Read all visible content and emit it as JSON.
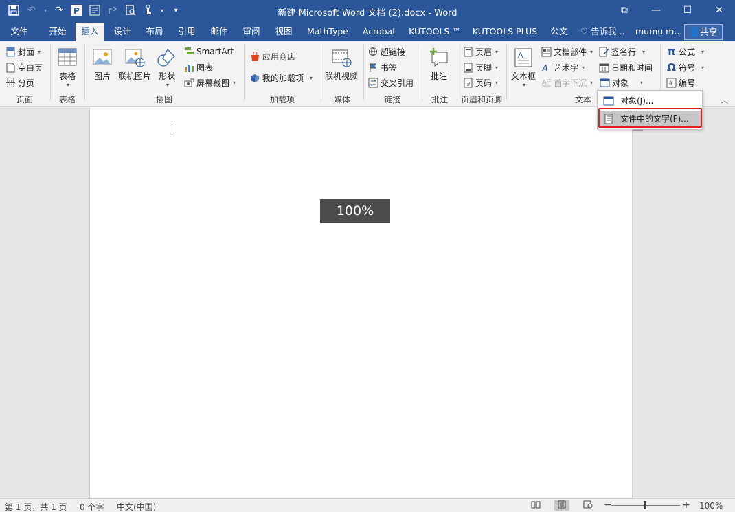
{
  "window": {
    "title": "新建 Microsoft Word 文档 (2).docx - Word",
    "controls": [
      "⧉",
      "—",
      "☐",
      "✕"
    ]
  },
  "qat": {
    "icons": [
      "save-icon",
      "undo-icon",
      "redo-icon",
      "powerpoint-icon",
      "mathtype-icon",
      "share-icon",
      "print-preview-icon",
      "touch-mode-icon",
      "customize-icon"
    ],
    "glyphs": [
      "💾",
      "↶",
      "↷",
      "P",
      "⊞",
      "↗",
      "🔍",
      "☝",
      "▾"
    ]
  },
  "tabs": [
    {
      "label": "文件"
    },
    {
      "label": "开始"
    },
    {
      "label": "插入"
    },
    {
      "label": "设计"
    },
    {
      "label": "布局"
    },
    {
      "label": "引用"
    },
    {
      "label": "邮件"
    },
    {
      "label": "审阅"
    },
    {
      "label": "视图"
    },
    {
      "label": "MathType"
    },
    {
      "label": "Acrobat"
    },
    {
      "label": "KUTOOLS ™"
    },
    {
      "label": "KUTOOLS PLUS"
    },
    {
      "label": "公文"
    }
  ],
  "tellme": "♡ 告诉我...",
  "user": "mumu m...",
  "share": "共享",
  "ribbon": {
    "pages": {
      "cover": "封面",
      "blank": "空白页",
      "break": "分页",
      "label": "页面"
    },
    "tables": {
      "table": "表格",
      "label": "表格"
    },
    "illustrations": {
      "picture": "图片",
      "online_picture": "联机图片",
      "shapes": "形状",
      "smartart": "SmartArt",
      "chart": "图表",
      "screenshot": "屏幕截图",
      "label": "插图"
    },
    "addins": {
      "store": "应用商店",
      "my_addins": "我的加载项",
      "label": "加载项"
    },
    "media": {
      "online_video": "联机视频",
      "label": "媒体"
    },
    "links": {
      "hyperlink": "超链接",
      "bookmark": "书签",
      "crossref": "交叉引用",
      "label": "链接"
    },
    "comments": {
      "comment": "批注",
      "label": "批注"
    },
    "headerfooter": {
      "header": "页眉",
      "footer": "页脚",
      "pagenum": "页码",
      "label": "页眉和页脚"
    },
    "text": {
      "textbox": "文本框",
      "docparts": "文档部件",
      "wordart": "艺术字",
      "dropcap": "首字下沉",
      "signature": "签名行",
      "datetime": "日期和时间",
      "object": "对象",
      "label": "文本"
    },
    "symbols": {
      "equation": "公式",
      "symbol": "符号",
      "number": "编号"
    }
  },
  "menu": {
    "items": [
      {
        "label": "对象(J)..."
      },
      {
        "label": "文件中的文字(F)..."
      }
    ]
  },
  "document": {
    "zoom_tip": "100%"
  },
  "status": {
    "page": "第 1 页，共 1 页",
    "words": "0 个字",
    "lang": "中文(中国)",
    "zoom": "100%",
    "zoom_level": 1.0
  }
}
